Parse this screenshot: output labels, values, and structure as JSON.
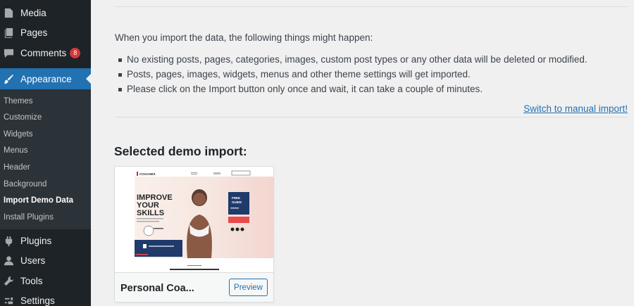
{
  "sidebar": {
    "items_top": [
      {
        "label": "Media",
        "icon": "media-icon"
      },
      {
        "label": "Pages",
        "icon": "pages-icon"
      },
      {
        "label": "Comments",
        "icon": "comments-icon",
        "badge": "8"
      }
    ],
    "active": {
      "label": "Appearance",
      "icon": "appearance-icon"
    },
    "submenu": [
      "Themes",
      "Customize",
      "Widgets",
      "Menus",
      "Header",
      "Background",
      "Import Demo Data",
      "Install Plugins"
    ],
    "current_submenu": "Import Demo Data",
    "items_bottom": [
      {
        "label": "Plugins",
        "icon": "plugins-icon"
      },
      {
        "label": "Users",
        "icon": "users-icon"
      },
      {
        "label": "Tools",
        "icon": "tools-icon"
      },
      {
        "label": "Settings",
        "icon": "settings-icon"
      }
    ]
  },
  "main": {
    "intro": "When you import the data, the following things might happen:",
    "bullets": [
      "No existing posts, pages, categories, images, custom post types or any other data will be deleted or modified.",
      "Posts, pages, images, widgets, menus and other theme settings will get imported.",
      "Please click on the Import button only once and wait, it can take a couple of minutes."
    ],
    "manual_link": "Switch to manual import!",
    "selected_heading": "Selected demo import:",
    "demo": {
      "name": "Personal Coa...",
      "preview_label": "Preview",
      "thumbnail": {
        "logo": "COACHES",
        "headline": [
          "IMPROVE",
          "YOUR",
          "SKILLS"
        ],
        "card": [
          "FREE",
          "GUIDE"
        ]
      }
    }
  },
  "colors": {
    "sidebar_bg": "#1d2327",
    "submenu_bg": "#2c3338",
    "accent": "#2271b1",
    "badge": "#d63638",
    "page_bg": "#f0f0f1"
  }
}
